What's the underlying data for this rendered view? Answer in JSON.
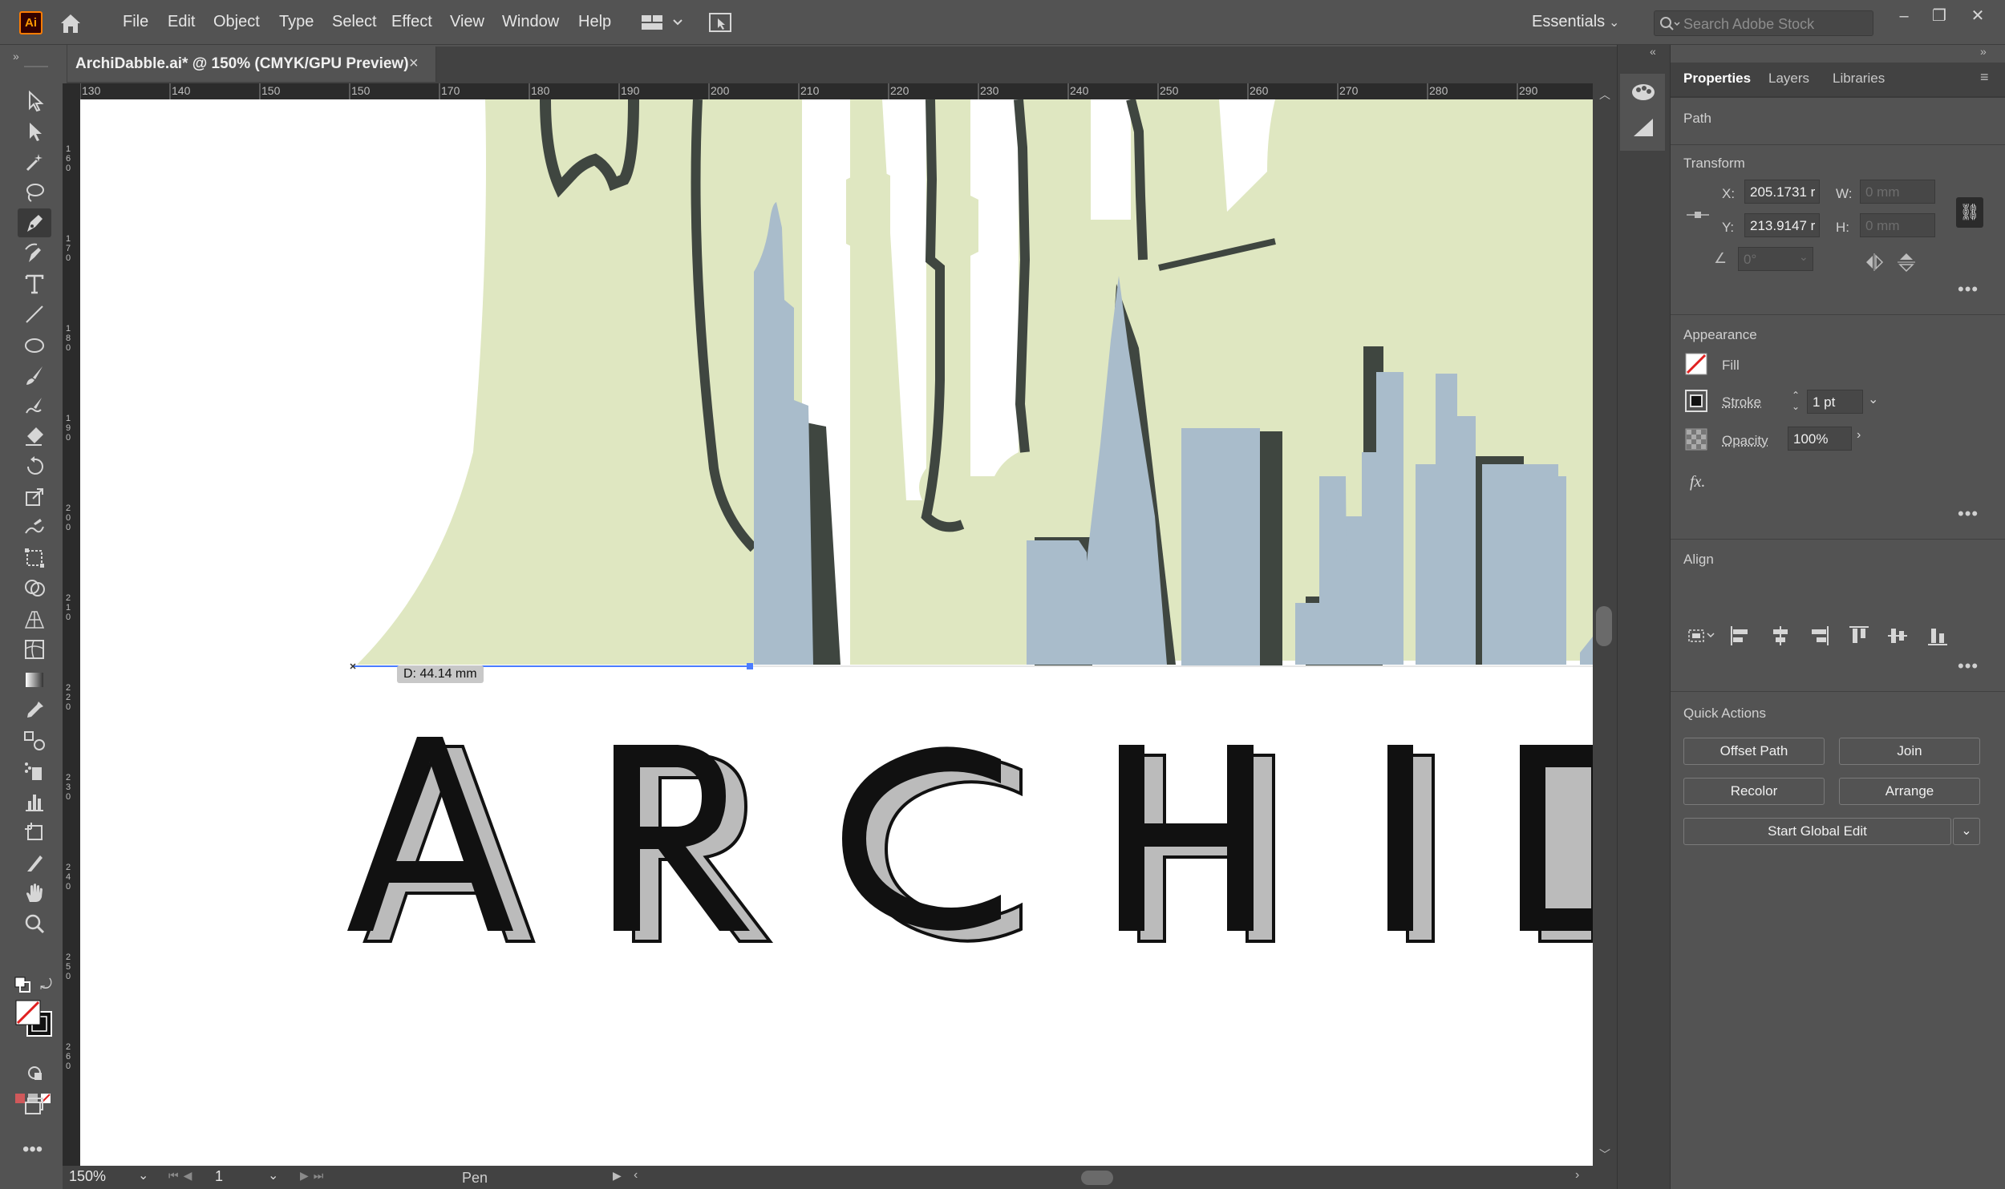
{
  "menubar": {
    "logo": "Ai",
    "menus": [
      "File",
      "Edit",
      "Object",
      "Type",
      "Select",
      "Effect",
      "View",
      "Window",
      "Help"
    ],
    "workspace": "Essentials",
    "search_placeholder": "Search Adobe Stock",
    "window_controls": [
      "minimize-icon",
      "restore-icon",
      "close-icon"
    ]
  },
  "document": {
    "tab_title": "ArchiDabble.ai* @ 150% (CMYK/GPU Preview)",
    "tab_close": "×"
  },
  "ruler": {
    "horizontal_ticks": [
      "130",
      "140",
      "150",
      "150",
      "170",
      "180",
      "190",
      "200",
      "210",
      "220",
      "230",
      "240",
      "250",
      "260",
      "270",
      "280",
      "290"
    ],
    "vertical_ticks": [
      "1 6 0",
      "1 7 0",
      "1 8 0",
      "1 9 0",
      "2 0 0",
      "2 1 0",
      "2 2 0",
      "2 3 0",
      "2 4 0",
      "2 5 0",
      "2 6 0"
    ]
  },
  "canvas": {
    "distance_tooltip": "D: 44.14 mm",
    "artwork_text": "ARCHID",
    "colors": {
      "foliage": "#dfe7c1",
      "outline": "#3f4640",
      "building": "#a9bccb",
      "letter": "#111111",
      "letter_shadow": "#bbbbbb",
      "guide": "#4a7cff"
    }
  },
  "statusbar": {
    "zoom": "150%",
    "artboard": "1",
    "current_tool": "Pen"
  },
  "panel": {
    "tabs": [
      "Properties",
      "Layers",
      "Libraries"
    ],
    "active_tab": "Properties",
    "selection_type": "Path",
    "transform": {
      "heading": "Transform",
      "x_label": "X:",
      "x_value": "205.1731 r",
      "y_label": "Y:",
      "y_value": "213.9147 r",
      "w_label": "W:",
      "w_value": "0 mm",
      "h_label": "H:",
      "h_value": "0 mm",
      "angle_value": "0°"
    },
    "appearance": {
      "heading": "Appearance",
      "fill_label": "Fill",
      "stroke_label": "Stroke",
      "stroke_value": "1 pt",
      "opacity_label": "Opacity",
      "opacity_value": "100%",
      "fx_label": "fx."
    },
    "align": {
      "heading": "Align"
    },
    "quick_actions": {
      "heading": "Quick Actions",
      "offset_path": "Offset Path",
      "join": "Join",
      "recolor": "Recolor",
      "arrange": "Arrange",
      "start_global_edit": "Start Global Edit"
    }
  }
}
